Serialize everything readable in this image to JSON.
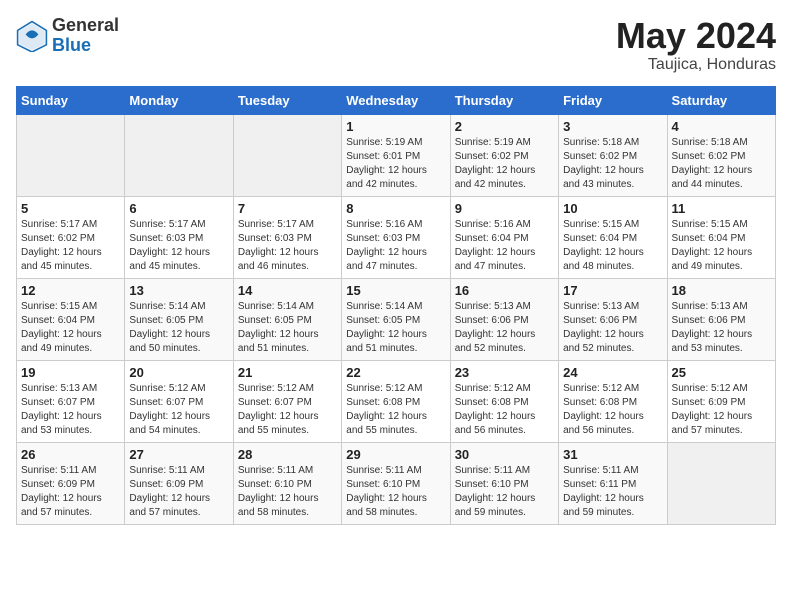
{
  "header": {
    "logo_line1": "General",
    "logo_line2": "Blue",
    "month": "May 2024",
    "location": "Taujica, Honduras"
  },
  "weekdays": [
    "Sunday",
    "Monday",
    "Tuesday",
    "Wednesday",
    "Thursday",
    "Friday",
    "Saturday"
  ],
  "weeks": [
    [
      {
        "day": "",
        "info": ""
      },
      {
        "day": "",
        "info": ""
      },
      {
        "day": "",
        "info": ""
      },
      {
        "day": "1",
        "info": "Sunrise: 5:19 AM\nSunset: 6:01 PM\nDaylight: 12 hours\nand 42 minutes."
      },
      {
        "day": "2",
        "info": "Sunrise: 5:19 AM\nSunset: 6:02 PM\nDaylight: 12 hours\nand 42 minutes."
      },
      {
        "day": "3",
        "info": "Sunrise: 5:18 AM\nSunset: 6:02 PM\nDaylight: 12 hours\nand 43 minutes."
      },
      {
        "day": "4",
        "info": "Sunrise: 5:18 AM\nSunset: 6:02 PM\nDaylight: 12 hours\nand 44 minutes."
      }
    ],
    [
      {
        "day": "5",
        "info": "Sunrise: 5:17 AM\nSunset: 6:02 PM\nDaylight: 12 hours\nand 45 minutes."
      },
      {
        "day": "6",
        "info": "Sunrise: 5:17 AM\nSunset: 6:03 PM\nDaylight: 12 hours\nand 45 minutes."
      },
      {
        "day": "7",
        "info": "Sunrise: 5:17 AM\nSunset: 6:03 PM\nDaylight: 12 hours\nand 46 minutes."
      },
      {
        "day": "8",
        "info": "Sunrise: 5:16 AM\nSunset: 6:03 PM\nDaylight: 12 hours\nand 47 minutes."
      },
      {
        "day": "9",
        "info": "Sunrise: 5:16 AM\nSunset: 6:04 PM\nDaylight: 12 hours\nand 47 minutes."
      },
      {
        "day": "10",
        "info": "Sunrise: 5:15 AM\nSunset: 6:04 PM\nDaylight: 12 hours\nand 48 minutes."
      },
      {
        "day": "11",
        "info": "Sunrise: 5:15 AM\nSunset: 6:04 PM\nDaylight: 12 hours\nand 49 minutes."
      }
    ],
    [
      {
        "day": "12",
        "info": "Sunrise: 5:15 AM\nSunset: 6:04 PM\nDaylight: 12 hours\nand 49 minutes."
      },
      {
        "day": "13",
        "info": "Sunrise: 5:14 AM\nSunset: 6:05 PM\nDaylight: 12 hours\nand 50 minutes."
      },
      {
        "day": "14",
        "info": "Sunrise: 5:14 AM\nSunset: 6:05 PM\nDaylight: 12 hours\nand 51 minutes."
      },
      {
        "day": "15",
        "info": "Sunrise: 5:14 AM\nSunset: 6:05 PM\nDaylight: 12 hours\nand 51 minutes."
      },
      {
        "day": "16",
        "info": "Sunrise: 5:13 AM\nSunset: 6:06 PM\nDaylight: 12 hours\nand 52 minutes."
      },
      {
        "day": "17",
        "info": "Sunrise: 5:13 AM\nSunset: 6:06 PM\nDaylight: 12 hours\nand 52 minutes."
      },
      {
        "day": "18",
        "info": "Sunrise: 5:13 AM\nSunset: 6:06 PM\nDaylight: 12 hours\nand 53 minutes."
      }
    ],
    [
      {
        "day": "19",
        "info": "Sunrise: 5:13 AM\nSunset: 6:07 PM\nDaylight: 12 hours\nand 53 minutes."
      },
      {
        "day": "20",
        "info": "Sunrise: 5:12 AM\nSunset: 6:07 PM\nDaylight: 12 hours\nand 54 minutes."
      },
      {
        "day": "21",
        "info": "Sunrise: 5:12 AM\nSunset: 6:07 PM\nDaylight: 12 hours\nand 55 minutes."
      },
      {
        "day": "22",
        "info": "Sunrise: 5:12 AM\nSunset: 6:08 PM\nDaylight: 12 hours\nand 55 minutes."
      },
      {
        "day": "23",
        "info": "Sunrise: 5:12 AM\nSunset: 6:08 PM\nDaylight: 12 hours\nand 56 minutes."
      },
      {
        "day": "24",
        "info": "Sunrise: 5:12 AM\nSunset: 6:08 PM\nDaylight: 12 hours\nand 56 minutes."
      },
      {
        "day": "25",
        "info": "Sunrise: 5:12 AM\nSunset: 6:09 PM\nDaylight: 12 hours\nand 57 minutes."
      }
    ],
    [
      {
        "day": "26",
        "info": "Sunrise: 5:11 AM\nSunset: 6:09 PM\nDaylight: 12 hours\nand 57 minutes."
      },
      {
        "day": "27",
        "info": "Sunrise: 5:11 AM\nSunset: 6:09 PM\nDaylight: 12 hours\nand 57 minutes."
      },
      {
        "day": "28",
        "info": "Sunrise: 5:11 AM\nSunset: 6:10 PM\nDaylight: 12 hours\nand 58 minutes."
      },
      {
        "day": "29",
        "info": "Sunrise: 5:11 AM\nSunset: 6:10 PM\nDaylight: 12 hours\nand 58 minutes."
      },
      {
        "day": "30",
        "info": "Sunrise: 5:11 AM\nSunset: 6:10 PM\nDaylight: 12 hours\nand 59 minutes."
      },
      {
        "day": "31",
        "info": "Sunrise: 5:11 AM\nSunset: 6:11 PM\nDaylight: 12 hours\nand 59 minutes."
      },
      {
        "day": "",
        "info": ""
      }
    ]
  ]
}
